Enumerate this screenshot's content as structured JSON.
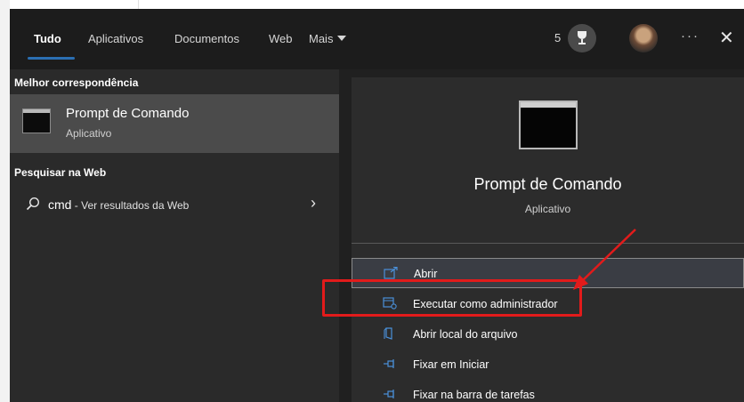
{
  "nav": {
    "tabs": [
      {
        "label": "Tudo",
        "active": true
      },
      {
        "label": "Aplicativos"
      },
      {
        "label": "Documentos"
      },
      {
        "label": "Web"
      },
      {
        "label": "Mais"
      }
    ],
    "points": "5",
    "more_label": "···",
    "close_label": "✕",
    "icons": {
      "trophy": "trophy-icon",
      "avatar": "user-avatar",
      "more": "ellipsis-icon",
      "close": "close-icon",
      "dropdown": "caret-down-icon"
    }
  },
  "results": {
    "best_match_heading": "Melhor correspondência",
    "best_match": {
      "title": "Prompt de Comando",
      "subtitle": "Aplicativo",
      "icon": "command-prompt-icon"
    },
    "web_heading": "Pesquisar na Web",
    "web_item": {
      "query": "cmd",
      "suffix": " - Ver resultados da Web",
      "icon": "search-icon",
      "chevron": "›"
    }
  },
  "preview": {
    "title": "Prompt de Comando",
    "subtitle": "Aplicativo",
    "icon": "command-prompt-icon",
    "actions": [
      {
        "label": "Abrir",
        "icon": "open-icon"
      },
      {
        "label": "Executar como administrador",
        "icon": "run-as-admin-icon"
      },
      {
        "label": "Abrir local do arquivo",
        "icon": "file-location-icon"
      },
      {
        "label": "Fixar em Iniciar",
        "icon": "pin-icon"
      },
      {
        "label": "Fixar na barra de tarefas",
        "icon": "pin-icon"
      }
    ]
  },
  "colors": {
    "accent": "#2b6fb3",
    "annotation": "#e21b1b",
    "action_icon": "#4a90d9"
  }
}
